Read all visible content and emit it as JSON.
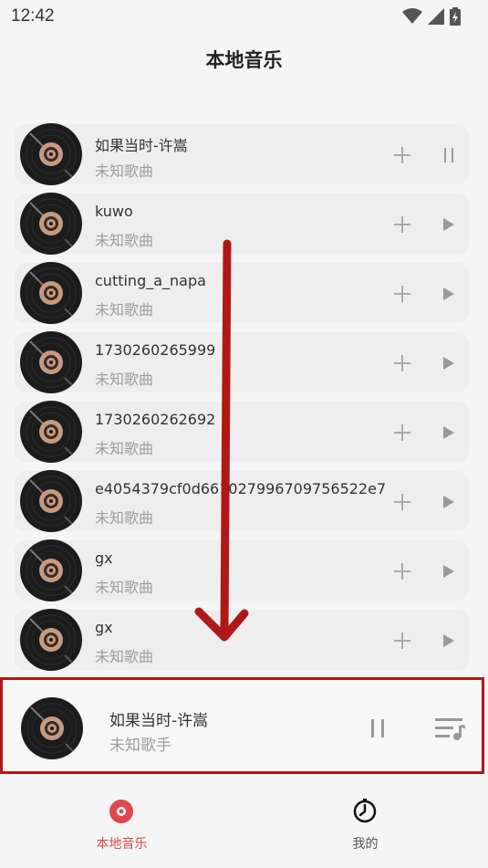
{
  "status_bar": {
    "time": "12:42"
  },
  "header": {
    "title": "本地音乐"
  },
  "songs": [
    {
      "title": "如果当时-许嵩",
      "artist": "未知歌曲",
      "state": "playing"
    },
    {
      "title": "kuwo",
      "artist": "未知歌曲",
      "state": "paused"
    },
    {
      "title": "cutting_a_napa",
      "artist": "未知歌曲",
      "state": "paused"
    },
    {
      "title": "1730260265999",
      "artist": "未知歌曲",
      "state": "paused"
    },
    {
      "title": "1730260262692",
      "artist": "未知歌曲",
      "state": "paused"
    },
    {
      "title": "e4054379cf0d661027996709756522e7",
      "artist": "未知歌曲",
      "state": "paused"
    },
    {
      "title": "gx",
      "artist": "未知歌曲",
      "state": "paused"
    },
    {
      "title": "gx",
      "artist": "未知歌曲",
      "state": "paused"
    }
  ],
  "player": {
    "title": "如果当时-许嵩",
    "artist": "未知歌手"
  },
  "tabs": [
    {
      "label": "本地音乐",
      "active": true,
      "icon": "disc-icon"
    },
    {
      "label": "我的",
      "active": false,
      "icon": "clock-icon"
    }
  ],
  "colors": {
    "accent": "#e0484c",
    "highlight_border": "#b01818",
    "arrow": "#b01818"
  }
}
